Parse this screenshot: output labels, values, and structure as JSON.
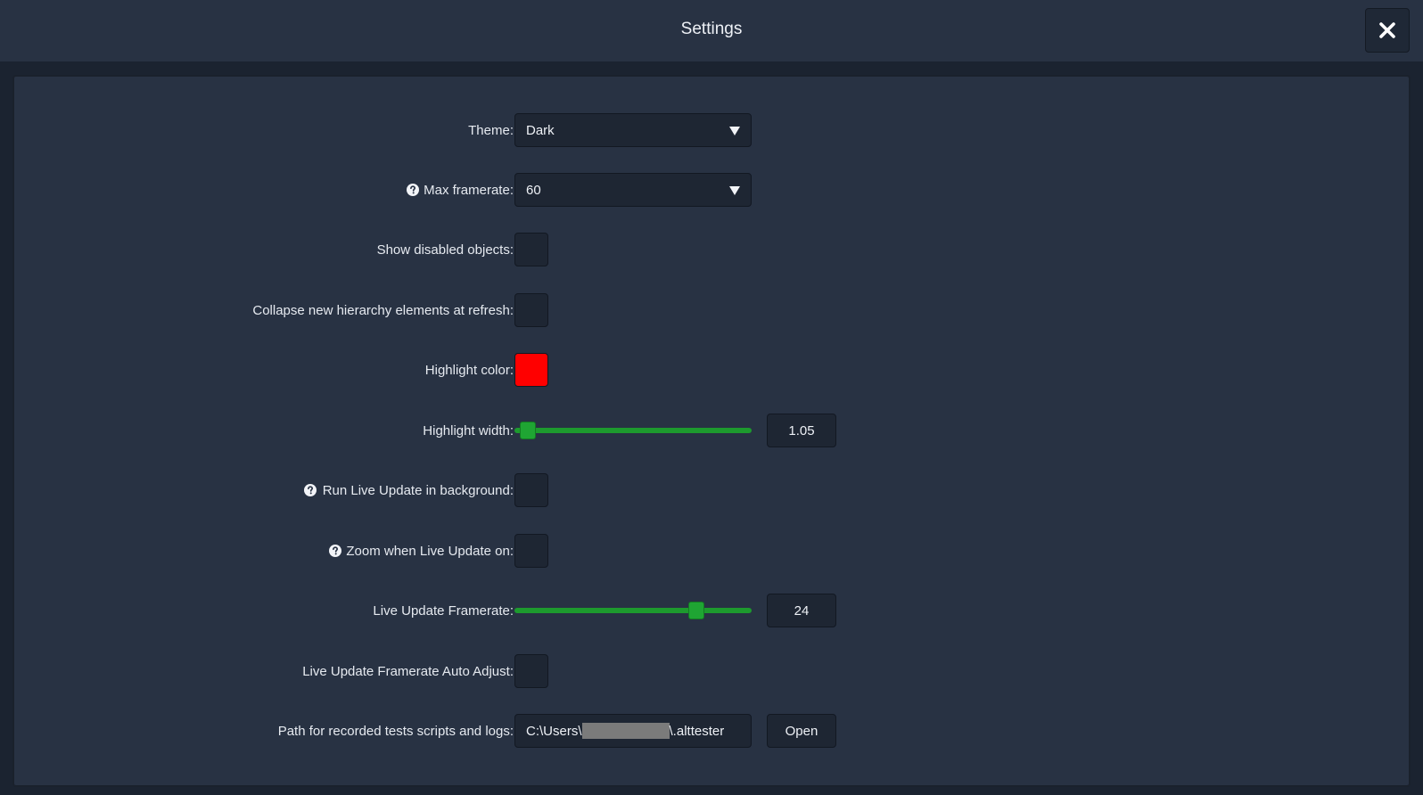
{
  "header": {
    "title": "Settings"
  },
  "settings": {
    "theme": {
      "label": "Theme:",
      "value": "Dark"
    },
    "max_framerate": {
      "label": "Max framerate:",
      "value": "60",
      "help": true
    },
    "show_disabled_objects": {
      "label": "Show disabled objects:",
      "checked": false
    },
    "collapse_hierarchy": {
      "label": "Collapse new hierarchy elements at refresh:",
      "checked": false
    },
    "highlight_color": {
      "label": "Highlight color:",
      "color": "#ff0000"
    },
    "highlight_width": {
      "label": "Highlight width:",
      "value": "1.05",
      "slider_fraction": 0.05
    },
    "run_live_update_background": {
      "label": "Run Live Update in background:",
      "checked": false,
      "help": true
    },
    "zoom_live_update": {
      "label": "Zoom when Live Update on:",
      "checked": false,
      "help": true
    },
    "live_update_framerate": {
      "label": "Live Update Framerate:",
      "value": "24",
      "slider_fraction": 0.77
    },
    "live_update_auto_adjust": {
      "label": "Live Update Framerate Auto Adjust:",
      "checked": false
    },
    "recorded_path": {
      "label": "Path for recorded tests scripts and logs:",
      "value_prefix": "C:\\Users\\",
      "value_suffix": "\\.alttester",
      "open_label": "Open"
    }
  },
  "icons": {
    "close": "close-icon",
    "help": "help-circle-icon",
    "dropdown": "caret-down-icon"
  },
  "colors": {
    "accent_green": "#1d9a2e",
    "panel_bg": "#283243",
    "highlight": "#ff0000"
  }
}
